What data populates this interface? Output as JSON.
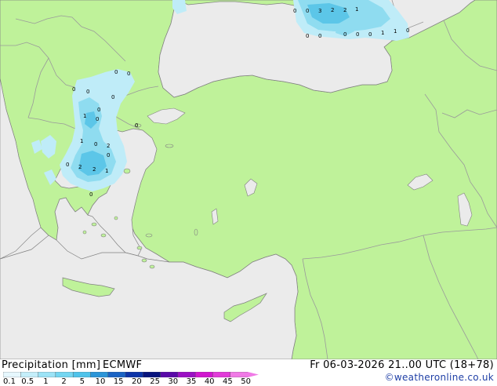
{
  "map": {
    "colors": {
      "sea": "#ebebeb",
      "land": "#bff29a",
      "border": "#9a9a9a",
      "coast": "#808080",
      "precip_light": "#bfecf8",
      "precip_mid": "#8fdcf0",
      "precip_strong": "#5cc6e8"
    },
    "precip_labels": [
      "0",
      "0",
      "3",
      "2",
      "2",
      "1",
      "0",
      "0",
      "0",
      "0",
      "0",
      "1",
      "1",
      "0",
      "0",
      "0",
      "0",
      "0",
      "0",
      "0",
      "1",
      "0",
      "0",
      "1",
      "0",
      "2",
      "0",
      "2",
      "2",
      "1",
      "0",
      "0"
    ]
  },
  "legend": {
    "title": "Precipitation [mm]",
    "model": "ECMWF",
    "datetime": "Fr 06-03-2026 21..00 UTC (18+78)",
    "credit": "©weatheronline.co.uk",
    "ticks": [
      "0.1",
      "0.5",
      "1",
      "2",
      "5",
      "10",
      "15",
      "20",
      "25",
      "30",
      "35",
      "40",
      "45",
      "50"
    ],
    "colors": [
      "#e6f7fd",
      "#c4eefa",
      "#9ce3f6",
      "#74d6f1",
      "#4fc3ea",
      "#2b95d8",
      "#1a63c4",
      "#0c33a8",
      "#07137d",
      "#5a0aa8",
      "#9b10c4",
      "#d116cf",
      "#e23bd9",
      "#f07ae6"
    ]
  }
}
